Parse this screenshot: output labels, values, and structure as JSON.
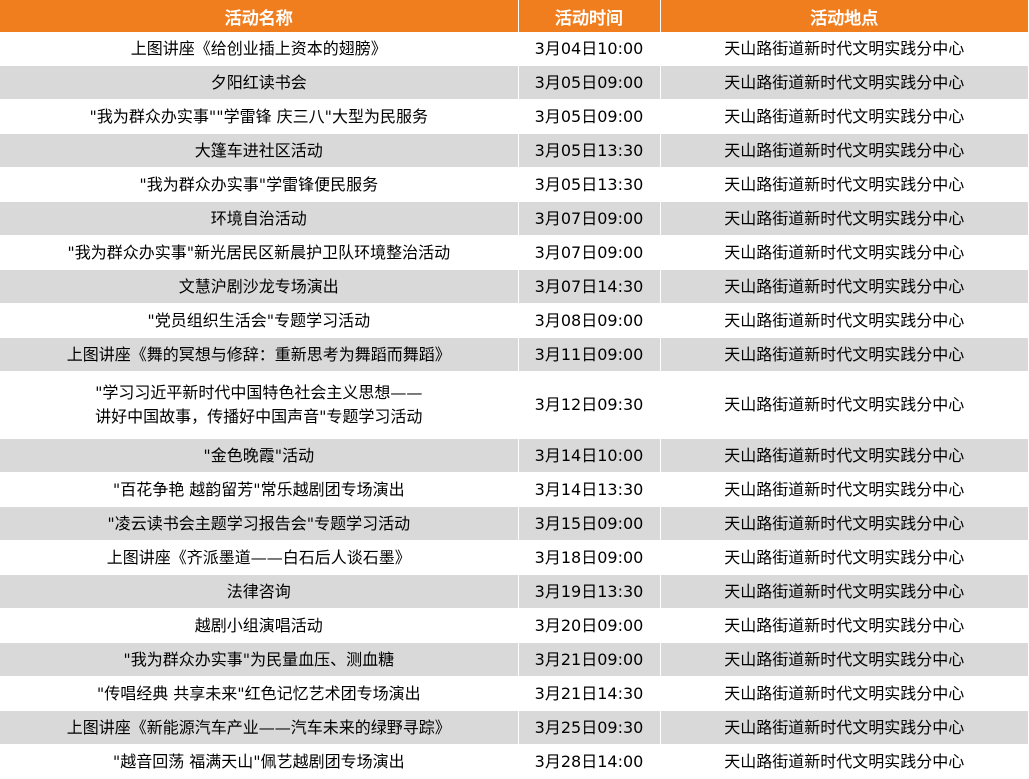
{
  "headers": [
    "活动名称",
    "活动时间",
    "活动地点"
  ],
  "rows": [
    {
      "name": "上图讲座《给创业插上资本的翅膀》",
      "time": "3月04日10:00",
      "place": "天山路街道新时代文明实践分中心"
    },
    {
      "name": "夕阳红读书会",
      "time": "3月05日09:00",
      "place": "天山路街道新时代文明实践分中心"
    },
    {
      "name": "\"我为群众办实事\"\"学雷锋 庆三八\"大型为民服务",
      "time": "3月05日09:00",
      "place": "天山路街道新时代文明实践分中心"
    },
    {
      "name": "大篷车进社区活动",
      "time": "3月05日13:30",
      "place": "天山路街道新时代文明实践分中心"
    },
    {
      "name": "\"我为群众办实事\"学雷锋便民服务",
      "time": "3月05日13:30",
      "place": "天山路街道新时代文明实践分中心"
    },
    {
      "name": "环境自治活动",
      "time": "3月07日09:00",
      "place": "天山路街道新时代文明实践分中心"
    },
    {
      "name": "\"我为群众办实事\"新光居民区新晨护卫队环境整治活动",
      "time": "3月07日09:00",
      "place": "天山路街道新时代文明实践分中心"
    },
    {
      "name": "文慧沪剧沙龙专场演出",
      "time": "3月07日14:30",
      "place": "天山路街道新时代文明实践分中心"
    },
    {
      "name": "\"党员组织生活会\"专题学习活动",
      "time": "3月08日09:00",
      "place": "天山路街道新时代文明实践分中心"
    },
    {
      "name": "上图讲座《舞的冥想与修辞：重新思考为舞蹈而舞蹈》",
      "time": "3月11日09:00",
      "place": "天山路街道新时代文明实践分中心"
    },
    {
      "name": "\"学习习近平新时代中国特色社会主义思想——",
      "name2": "讲好中国故事，传播好中国声音\"专题学习活动",
      "time": "3月12日09:30",
      "place": "天山路街道新时代文明实践分中心"
    },
    {
      "name": "\"金色晚霞\"活动",
      "time": "3月14日10:00",
      "place": "天山路街道新时代文明实践分中心"
    },
    {
      "name": "\"百花争艳 越韵留芳\"常乐越剧团专场演出",
      "time": "3月14日13:30",
      "place": "天山路街道新时代文明实践分中心"
    },
    {
      "name": "\"凌云读书会主题学习报告会\"专题学习活动",
      "time": "3月15日09:00",
      "place": "天山路街道新时代文明实践分中心"
    },
    {
      "name": "上图讲座《齐派墨道——白石后人谈石墨》",
      "time": "3月18日09:00",
      "place": "天山路街道新时代文明实践分中心"
    },
    {
      "name": "法律咨询",
      "time": "3月19日13:30",
      "place": "天山路街道新时代文明实践分中心"
    },
    {
      "name": "越剧小组演唱活动",
      "time": "3月20日09:00",
      "place": "天山路街道新时代文明实践分中心"
    },
    {
      "name": "\"我为群众办实事\"为民量血压、测血糖",
      "time": "3月21日09:00",
      "place": "天山路街道新时代文明实践分中心"
    },
    {
      "name": "\"传唱经典  共享未来\"红色记忆艺术团专场演出",
      "time": "3月21日14:30",
      "place": "天山路街道新时代文明实践分中心"
    },
    {
      "name": "上图讲座《新能源汽车产业——汽车未来的绿野寻踪》",
      "time": "3月25日09:30",
      "place": "天山路街道新时代文明实践分中心"
    },
    {
      "name": "\"越音回荡 福满天山\"佩艺越剧团专场演出",
      "time": "3月28日14:00",
      "place": "天山路街道新时代文明实践分中心"
    }
  ],
  "colors": {
    "header_bg": "#f07e1f",
    "header_text": "#ffffff",
    "stripe": "#d9d9d9"
  }
}
